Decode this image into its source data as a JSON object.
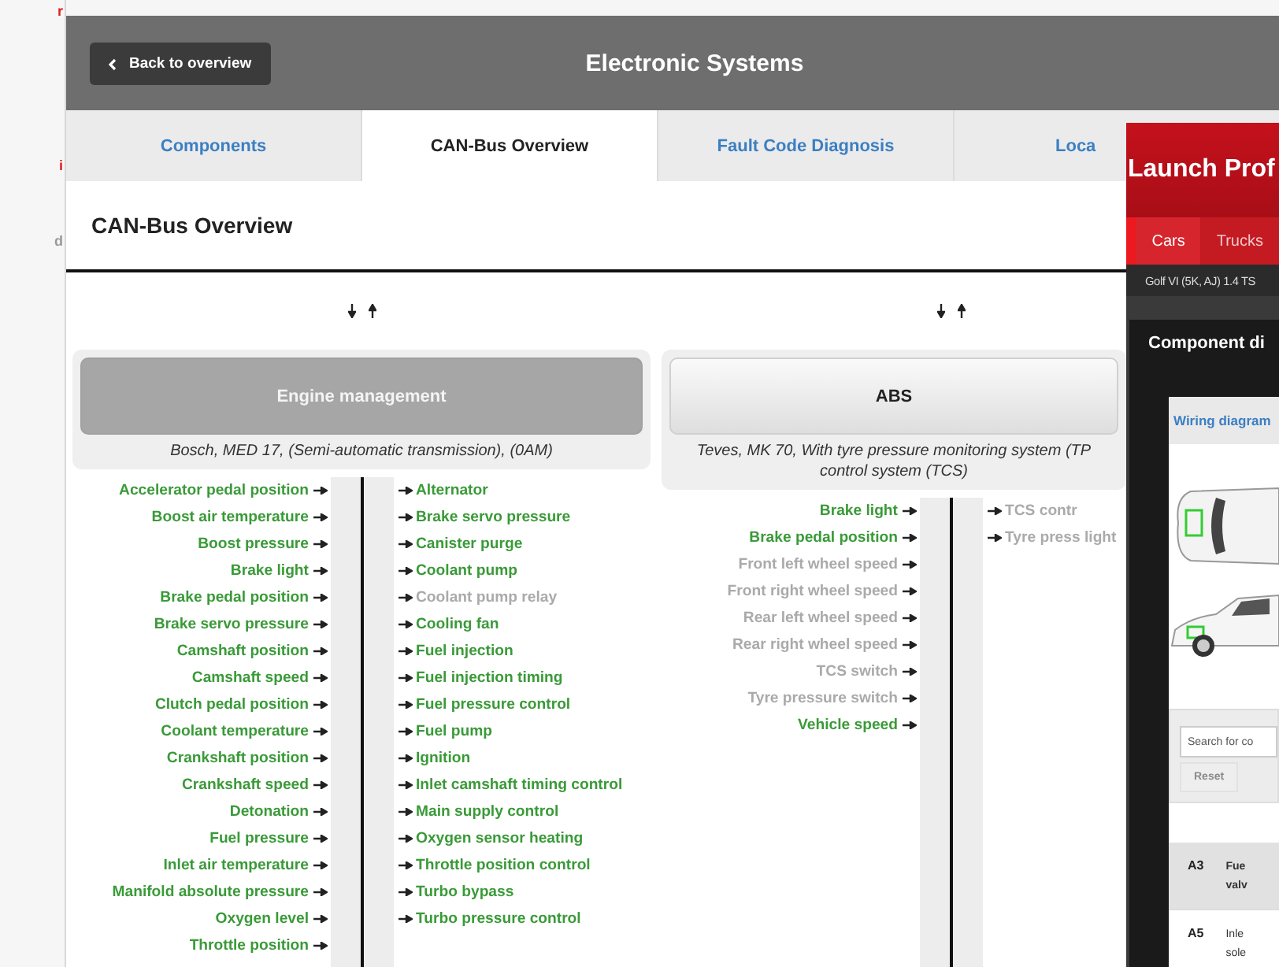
{
  "background_page": {
    "fragments": [
      {
        "text": "r",
        "kind": "link"
      },
      {
        "text": "i",
        "kind": "link"
      },
      {
        "text": "d",
        "kind": "text"
      }
    ]
  },
  "header": {
    "back_button": "Back to overview",
    "title": "Electronic Systems"
  },
  "tabs": [
    {
      "label": "Components",
      "selected": false
    },
    {
      "label": "CAN-Bus Overview",
      "selected": true
    },
    {
      "label": "Fault Code Diagnosis",
      "selected": false
    },
    {
      "label": "Loca",
      "selected": false
    }
  ],
  "section_title": "CAN-Bus Overview",
  "modules": [
    {
      "name": "Engine management",
      "selected": true,
      "description": [
        "Bosch, MED 17, (Semi-automatic transmission), (0AM)"
      ],
      "inputs": [
        {
          "label": "Accelerator pedal position",
          "available": true
        },
        {
          "label": "Boost air temperature",
          "available": true
        },
        {
          "label": "Boost pressure",
          "available": true
        },
        {
          "label": "Brake light",
          "available": true
        },
        {
          "label": "Brake pedal position",
          "available": true
        },
        {
          "label": "Brake servo pressure",
          "available": true
        },
        {
          "label": "Camshaft position",
          "available": true
        },
        {
          "label": "Camshaft speed",
          "available": true
        },
        {
          "label": "Clutch pedal position",
          "available": true
        },
        {
          "label": "Coolant temperature",
          "available": true
        },
        {
          "label": "Crankshaft position",
          "available": true
        },
        {
          "label": "Crankshaft speed",
          "available": true
        },
        {
          "label": "Detonation",
          "available": true
        },
        {
          "label": "Fuel pressure",
          "available": true
        },
        {
          "label": "Inlet air temperature",
          "available": true
        },
        {
          "label": "Manifold absolute pressure",
          "available": true
        },
        {
          "label": "Oxygen level",
          "available": true
        },
        {
          "label": "Throttle position",
          "available": true
        }
      ],
      "outputs": [
        {
          "label": "Alternator",
          "available": true
        },
        {
          "label": "Brake servo pressure",
          "available": true
        },
        {
          "label": "Canister purge",
          "available": true
        },
        {
          "label": "Coolant pump",
          "available": true
        },
        {
          "label": "Coolant pump relay",
          "available": false
        },
        {
          "label": "Cooling fan",
          "available": true
        },
        {
          "label": "Fuel injection",
          "available": true
        },
        {
          "label": "Fuel injection timing",
          "available": true
        },
        {
          "label": "Fuel pressure control",
          "available": true
        },
        {
          "label": "Fuel pump",
          "available": true
        },
        {
          "label": "Ignition",
          "available": true
        },
        {
          "label": "Inlet camshaft timing control",
          "available": true
        },
        {
          "label": "Main supply control",
          "available": true
        },
        {
          "label": "Oxygen sensor heating",
          "available": true
        },
        {
          "label": "Throttle position control",
          "available": true
        },
        {
          "label": "Turbo bypass",
          "available": true
        },
        {
          "label": "Turbo pressure control",
          "available": true
        }
      ]
    },
    {
      "name": "ABS",
      "selected": false,
      "description": [
        "Teves, MK 70, With tyre pressure monitoring system (TP",
        "control system (TCS)"
      ],
      "inputs": [
        {
          "label": "Brake light",
          "available": true
        },
        {
          "label": "Brake pedal position",
          "available": true
        },
        {
          "label": "Front left wheel speed",
          "available": false
        },
        {
          "label": "Front right wheel speed",
          "available": false
        },
        {
          "label": "Rear left wheel speed",
          "available": false
        },
        {
          "label": "Rear right wheel speed",
          "available": false
        },
        {
          "label": "TCS switch",
          "available": false
        },
        {
          "label": "Tyre pressure switch",
          "available": false
        },
        {
          "label": "Vehicle speed",
          "available": true
        }
      ],
      "outputs": [
        {
          "label": "TCS contr",
          "available": false
        },
        {
          "label": "Tyre press light",
          "available": false
        }
      ]
    }
  ],
  "launch_window": {
    "title": "Launch Prof",
    "nav_tabs": [
      {
        "label": "Cars",
        "selected": true
      },
      {
        "label": "Trucks",
        "selected": false
      }
    ],
    "vehicle": "Golf VI (5K, AJ) 1.4 TS",
    "panel_title": "Component di",
    "view_tab": "Wiring diagram",
    "search": {
      "placeholder": "Search for co",
      "reset_button": "Reset",
      "reset_disabled": true
    },
    "components": [
      {
        "code": "A3",
        "name": "Fue valv",
        "selected": true
      },
      {
        "code": "A5",
        "name": "Inle sole",
        "selected": false
      }
    ]
  }
}
